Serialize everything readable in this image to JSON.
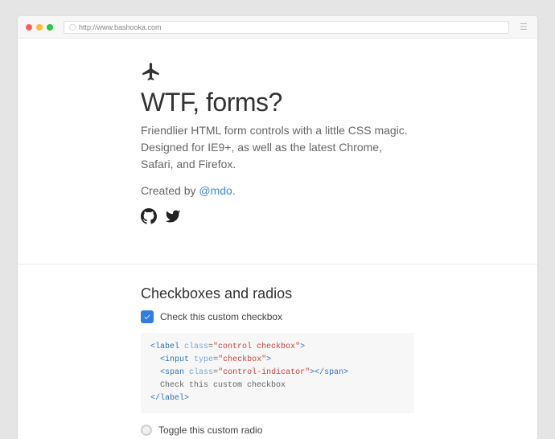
{
  "browser": {
    "url": "http://www.bashooka.com"
  },
  "header": {
    "title": "WTF, forms?",
    "lead": "Friendlier HTML form controls with a little CSS magic. Designed for IE9+, as well as the latest Chrome, Safari, and Firefox.",
    "created_prefix": "Created by ",
    "created_link": "@mdo",
    "created_suffix": "."
  },
  "section": {
    "heading": "Checkboxes and radios",
    "checkbox_label": "Check this custom checkbox",
    "radio_label": "Toggle this custom radio"
  },
  "code": {
    "l1_indent": "",
    "l1_open": "<label",
    "l1_attr": " class",
    "l1_eq": "=",
    "l1_str": "\"control checkbox\"",
    "l1_close": ">",
    "l2_indent": "  ",
    "l2_open": "<input",
    "l2_attr": " type",
    "l2_eq": "=",
    "l2_str": "\"checkbox\"",
    "l2_close": ">",
    "l3_indent": "  ",
    "l3_open": "<span",
    "l3_attr": " class",
    "l3_eq": "=",
    "l3_str": "\"control-indicator\"",
    "l3_close": "></span>",
    "l4": "  Check this custom checkbox",
    "l5": "</label>"
  }
}
